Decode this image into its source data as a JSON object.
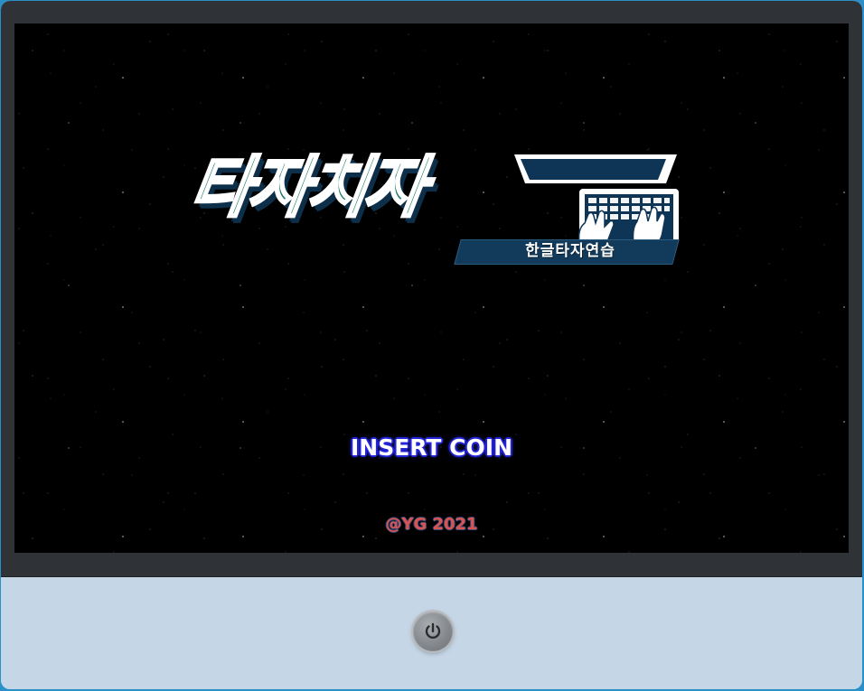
{
  "logo": {
    "title": "타자치자",
    "subtitle": "한글타자연습"
  },
  "screen": {
    "prompt": "INSERT COIN",
    "copyright": "@YG 2021"
  },
  "controls": {
    "power_icon": "power-icon"
  },
  "colors": {
    "device_border": "#2c90c8",
    "bezel": "#2f3338",
    "base": "#c5d6e6",
    "screen_bg": "#000000",
    "logo_green": "#17786a",
    "logo_navy": "#0d2f4a",
    "prompt_outline": "#2424d8",
    "copyright_text": "#d9534f"
  }
}
